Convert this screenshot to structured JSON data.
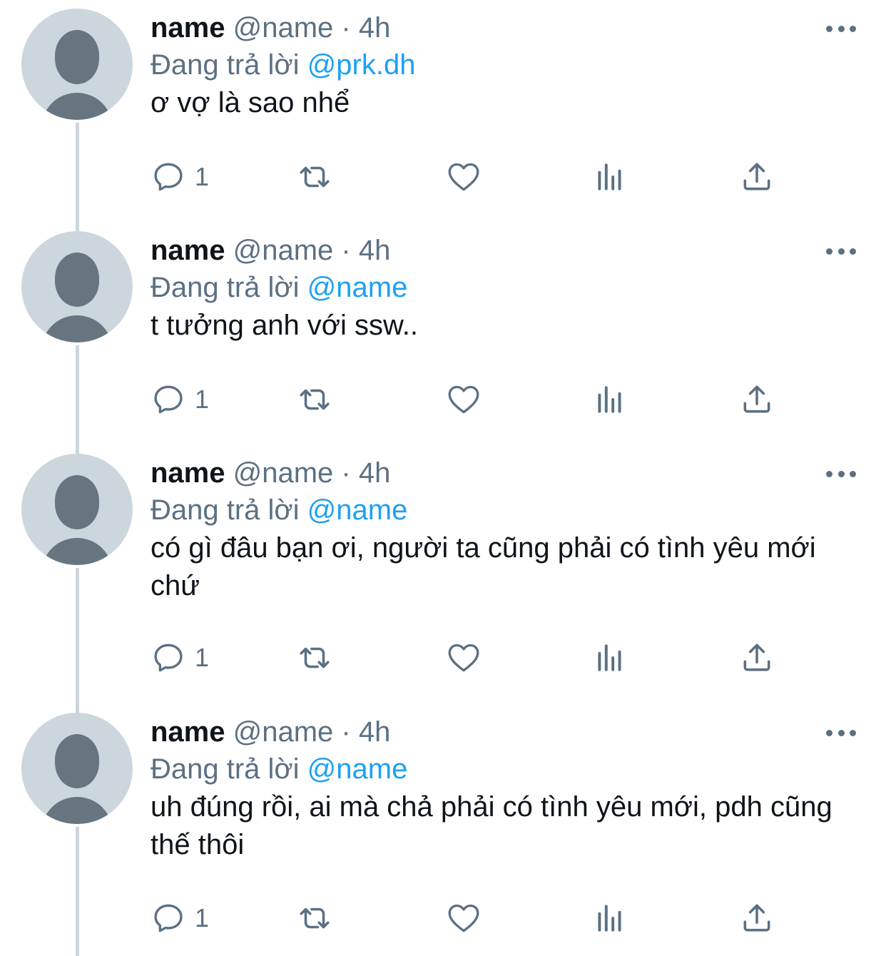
{
  "tweets": [
    {
      "name": "name",
      "handle": "@name",
      "dot": "·",
      "time": "4h",
      "reply_prefix": "Đang trả lời",
      "reply_to": "@prk.dh",
      "text": "ơ vợ là sao nhể",
      "reply_count": "1"
    },
    {
      "name": "name",
      "handle": "@name",
      "dot": "·",
      "time": "4h",
      "reply_prefix": "Đang trả lời",
      "reply_to": "@name",
      "text": "t tưởng anh với ssw..",
      "reply_count": "1"
    },
    {
      "name": "name",
      "handle": "@name",
      "dot": "·",
      "time": "4h",
      "reply_prefix": "Đang trả lời",
      "reply_to": "@name",
      "text": "có gì đâu bạn ơi, người ta cũng phải có tình yêu mới chứ",
      "reply_count": "1"
    },
    {
      "name": "name",
      "handle": "@name",
      "dot": "·",
      "time": "4h",
      "reply_prefix": "Đang trả lời",
      "reply_to": "@name",
      "text": "uh đúng rồi, ai mà chả phải có tình yêu mới, pdh cũng thế thôi",
      "reply_count": "1"
    }
  ],
  "icons": {
    "reply": "reply-icon",
    "retweet": "retweet-icon",
    "like": "heart-icon",
    "analytics": "analytics-icon",
    "share": "share-icon",
    "more": "more-icon"
  },
  "colors": {
    "text": "#0f1419",
    "secondary": "#5b7083",
    "mention": "#1da1f2",
    "avatar_bg": "#ccd6dd",
    "avatar_fg": "#66757f"
  }
}
